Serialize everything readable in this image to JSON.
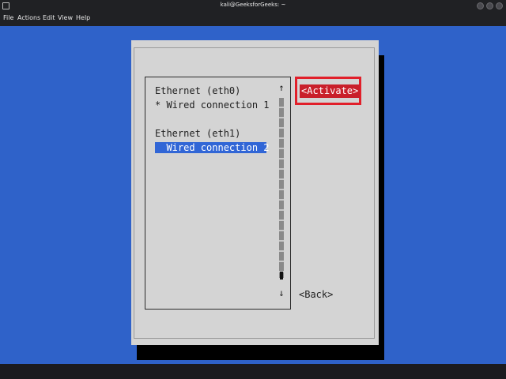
{
  "window": {
    "title": "kali@GeeksforGeeks: ~"
  },
  "menu": [
    {
      "label": "File"
    },
    {
      "label": "Actions"
    },
    {
      "label": "Edit"
    },
    {
      "label": "View"
    },
    {
      "label": "Help"
    }
  ],
  "list": {
    "lines": [
      {
        "text": "Ethernet (eth0)",
        "selected": false
      },
      {
        "text": "* Wired connection 1",
        "selected": false
      },
      {
        "text": "",
        "selected": false
      },
      {
        "text": "Ethernet (eth1)",
        "selected": false
      },
      {
        "text": "  Wired connection 2",
        "selected": true
      }
    ],
    "scroll_up_glyph": "↑",
    "scroll_down_glyph": "↓"
  },
  "buttons": {
    "activate": "<Activate>",
    "back": "<Back>"
  },
  "colors": {
    "terminal_bg": "#2f62c9",
    "dialog_bg": "#d4d4d4",
    "selection": "#3166d6",
    "activate_bg": "#c91f2a",
    "highlight_border": "#e11f2a"
  }
}
